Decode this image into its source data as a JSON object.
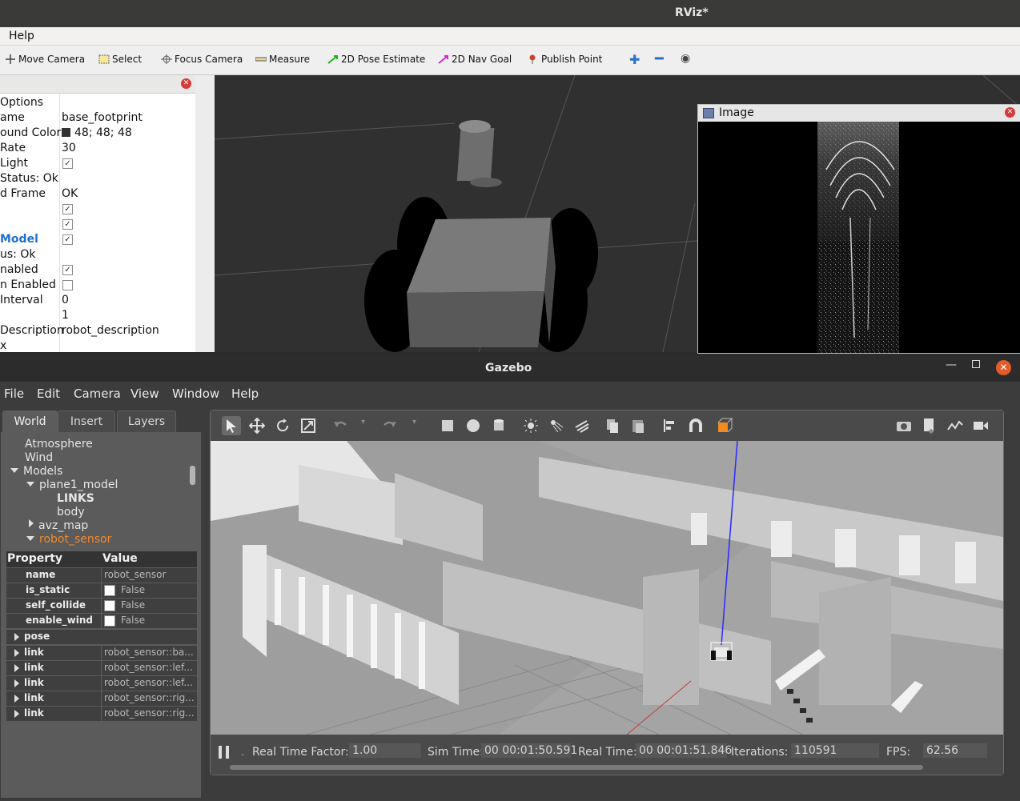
{
  "rviz": {
    "title": "RViz*",
    "menu": {
      "help": "Help"
    },
    "toolbar": {
      "move_camera": "Move Camera",
      "select": "Select",
      "focus_camera": "Focus Camera",
      "measure": "Measure",
      "pose_estimate": "2D Pose Estimate",
      "nav_goal": "2D Nav Goal",
      "publish_point": "Publish Point"
    },
    "displays": {
      "rows": [
        {
          "key": "Options",
          "value": ""
        },
        {
          "key": "ame",
          "value": "base_footprint"
        },
        {
          "key": "ound Color",
          "value": "48; 48; 48"
        },
        {
          "key": "Rate",
          "value": "30"
        },
        {
          "key": "Light",
          "value": ""
        },
        {
          "key": "Status: Ok",
          "value": ""
        },
        {
          "key": "d Frame",
          "value": "OK"
        },
        {
          "key": "",
          "value": ""
        },
        {
          "key": "",
          "value": ""
        },
        {
          "key": "Model",
          "value": ""
        },
        {
          "key": "us: Ok",
          "value": ""
        },
        {
          "key": "nabled",
          "value": ""
        },
        {
          "key": "n Enabled",
          "value": ""
        },
        {
          "key": "Interval",
          "value": "0"
        },
        {
          "key": "",
          "value": "1"
        },
        {
          "key": "Description",
          "value": "robot_description"
        },
        {
          "key": "x",
          "value": ""
        }
      ]
    },
    "image_panel": {
      "title": "Image"
    }
  },
  "gazebo": {
    "title": "Gazebo",
    "menu": {
      "file": "File",
      "edit": "Edit",
      "camera": "Camera",
      "view": "View",
      "window": "Window",
      "help": "Help"
    },
    "tabs": {
      "world": "World",
      "insert": "Insert",
      "layers": "Layers"
    },
    "tree": {
      "atmosphere": "Atmosphere",
      "wind": "Wind",
      "models": "Models",
      "plane1_model": "plane1_model",
      "links": "LINKS",
      "body": "body",
      "avz_map": "avz_map",
      "robot_sensor": "robot_sensor"
    },
    "properties": {
      "header_property": "Property",
      "header_value": "Value",
      "name_key": "name",
      "name_value": "robot_sensor",
      "is_static_key": "is_static",
      "is_static_value": "False",
      "self_collide_key": "self_collide",
      "self_collide_value": "False",
      "enable_wind_key": "enable_wind",
      "enable_wind_value": "False",
      "pose_key": "pose",
      "links": [
        {
          "key": "link",
          "value": "robot_sensor::ba..."
        },
        {
          "key": "link",
          "value": "robot_sensor::lef..."
        },
        {
          "key": "link",
          "value": "robot_sensor::lef..."
        },
        {
          "key": "link",
          "value": "robot_sensor::rig..."
        },
        {
          "key": "link",
          "value": "robot_sensor::rig..."
        }
      ]
    },
    "status": {
      "rtf_label": "Real Time Factor:",
      "rtf_value": "1.00",
      "sim_label": "Sim Time:",
      "sim_value": "00 00:01:50.591",
      "real_label": "Real Time:",
      "real_value": "00 00:01:51.846",
      "iter_label": "Iterations:",
      "iter_value": "110591",
      "fps_label": "FPS:",
      "fps_value": "62.56"
    }
  },
  "colors": {
    "accent_orange": "#f08a2c",
    "rviz_blue": "#1f6fd1",
    "close_red": "#d63a3a"
  }
}
